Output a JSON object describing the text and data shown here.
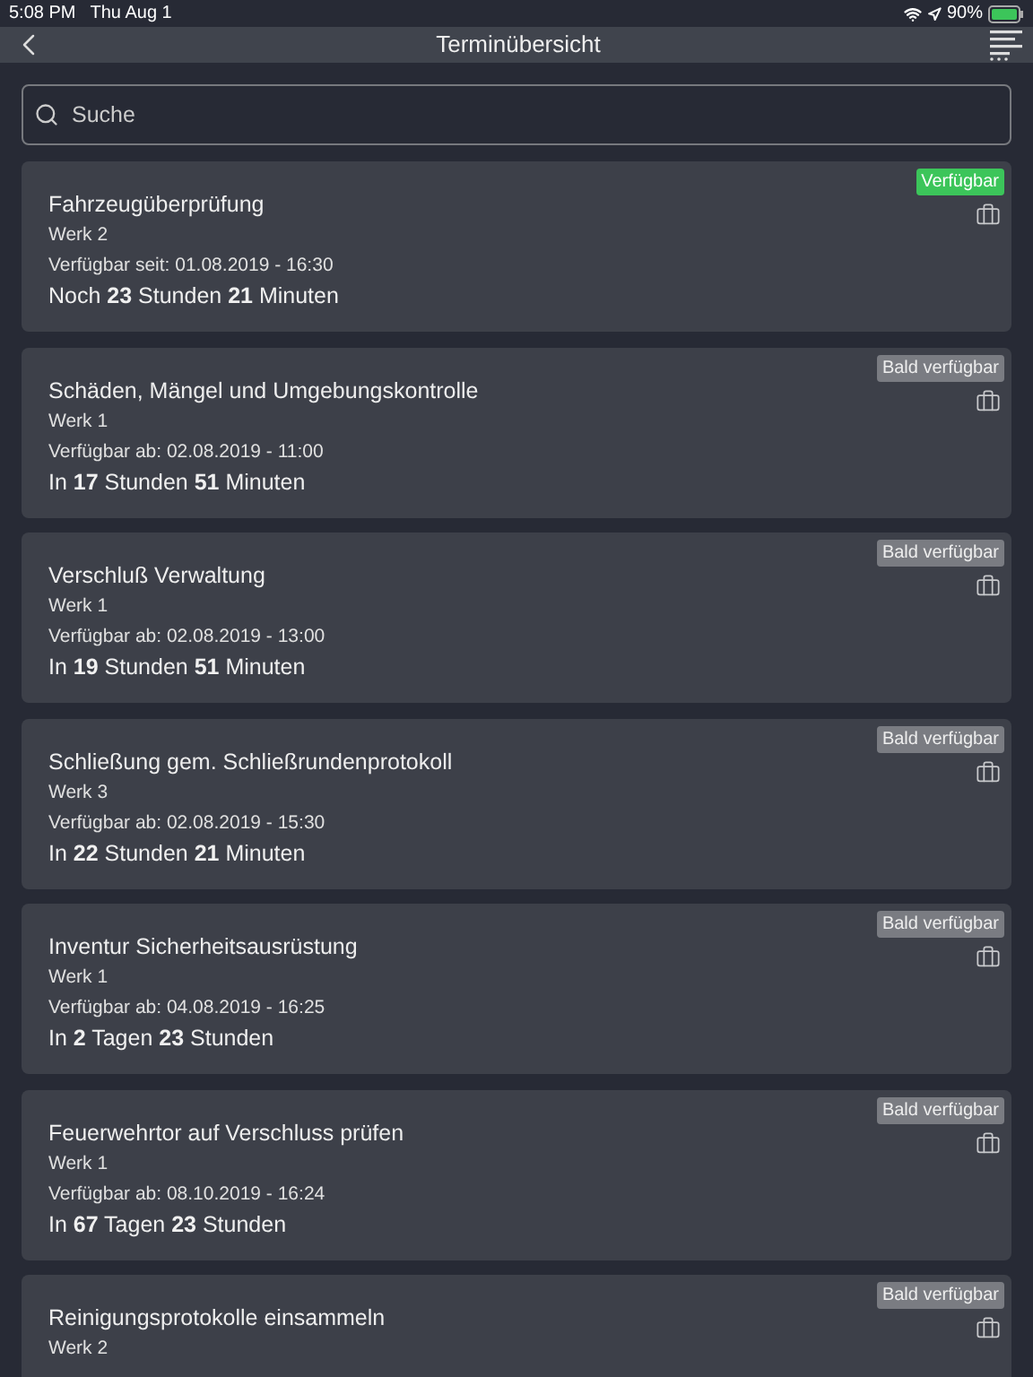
{
  "status_bar": {
    "time": "5:08 PM",
    "date": "Thu Aug 1",
    "battery_text": "90%"
  },
  "nav_bar": {
    "title": "Terminübersicht"
  },
  "search": {
    "placeholder": "Suche"
  },
  "appointments": [
    {
      "title": "Fahrzeugüberprüfung",
      "site": "Werk 2",
      "availability": "Verfügbar seit: 01.08.2019 - 16:30",
      "countdown": "Noch **23** Stunden **21** Minuten",
      "badge": {
        "kind": "available",
        "label": "Verfügbar"
      }
    },
    {
      "title": "Schäden, Mängel und Umgebungskontrolle",
      "site": "Werk 1",
      "availability": "Verfügbar ab: 02.08.2019 - 11:00",
      "countdown": "In **17** Stunden **51** Minuten",
      "badge": {
        "kind": "soon",
        "label": "Bald verfügbar"
      }
    },
    {
      "title": "Verschluß Verwaltung",
      "site": "Werk 1",
      "availability": "Verfügbar ab: 02.08.2019 - 13:00",
      "countdown": "In **19** Stunden **51** Minuten",
      "badge": {
        "kind": "soon",
        "label": "Bald verfügbar"
      }
    },
    {
      "title": "Schließung gem. Schließrundenprotokoll",
      "site": "Werk 3",
      "availability": "Verfügbar ab: 02.08.2019 - 15:30",
      "countdown": "In **22** Stunden **21** Minuten",
      "badge": {
        "kind": "soon",
        "label": "Bald verfügbar"
      }
    },
    {
      "title": "Inventur Sicherheitsausrüstung",
      "site": "Werk 1",
      "availability": "Verfügbar ab: 04.08.2019 - 16:25",
      "countdown": "In **2** Tagen **23** Stunden",
      "badge": {
        "kind": "soon",
        "label": "Bald verfügbar"
      }
    },
    {
      "title": "Feuerwehrtor auf Verschluss prüfen",
      "site": "Werk 1",
      "availability": "Verfügbar ab: 08.10.2019 - 16:24",
      "countdown": "In **67** Tagen **23** Stunden",
      "badge": {
        "kind": "soon",
        "label": "Bald verfügbar"
      }
    },
    {
      "title": "Reinigungsprotokolle einsammeln",
      "site": "Werk 2",
      "badge": {
        "kind": "soon",
        "label": "Bald verfügbar"
      }
    }
  ]
}
